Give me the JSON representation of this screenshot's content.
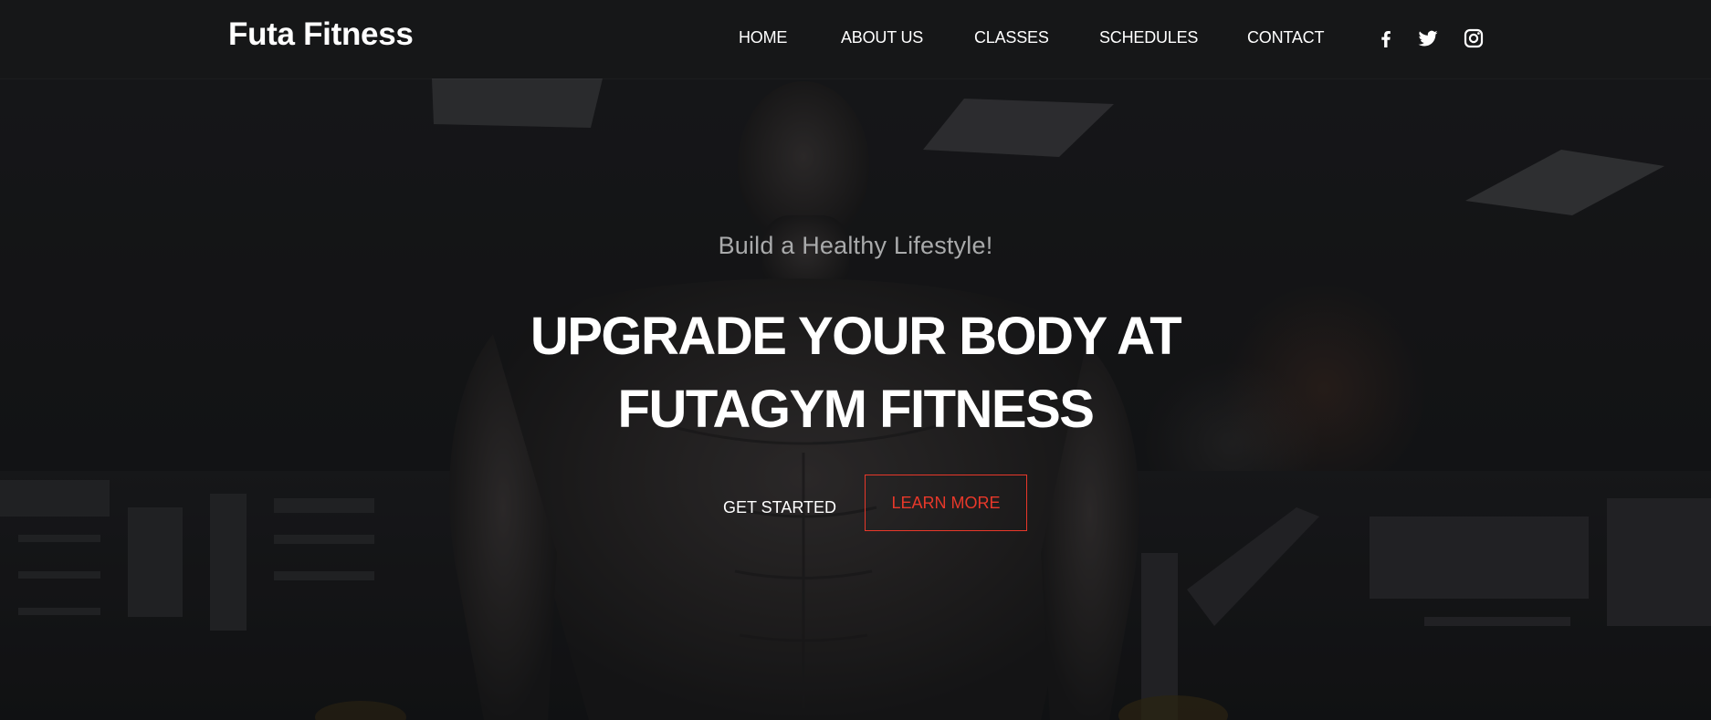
{
  "brand": {
    "name": "Futa Fitness"
  },
  "nav": {
    "links": [
      "HOME",
      "ABOUT US",
      "CLASSES",
      "SCHEDULES",
      "CONTACT"
    ],
    "social": [
      "facebook-icon",
      "twitter-icon",
      "instagram-icon"
    ]
  },
  "hero": {
    "tagline": "Build a Healthy Lifestyle!",
    "headline_line1": "UPGRADE YOUR BODY AT",
    "headline_line2": "FUTAGYM FITNESS",
    "primary_cta": "GET STARTED",
    "secondary_cta": "LEARN MORE"
  },
  "colors": {
    "background": "#141516",
    "navbar": "#161718",
    "text": "#ffffff",
    "muted_text": "#a9aaab",
    "accent": "#e8382a"
  }
}
